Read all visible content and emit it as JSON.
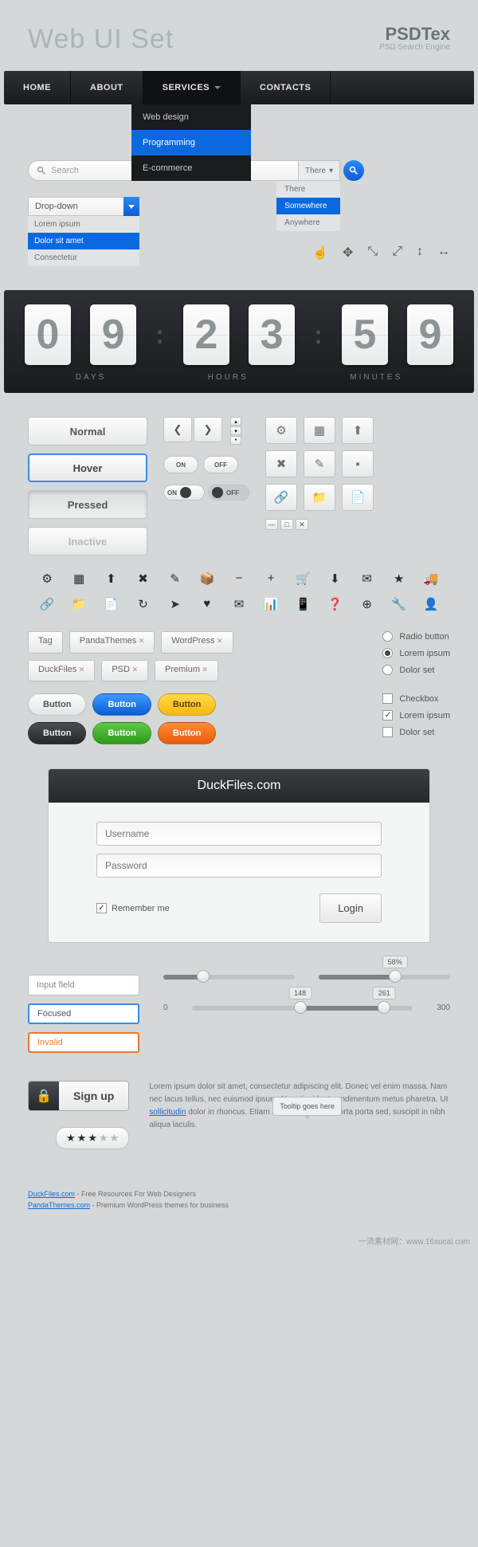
{
  "header": {
    "title": "Web UI Set",
    "brand": "PSD",
    "brand2": "Tex",
    "brand_sub": "PSD Search Engine"
  },
  "nav": {
    "items": [
      "HOME",
      "ABOUT",
      "SERVICES",
      "CONTACTS"
    ],
    "submenu": [
      "Web design",
      "Programming",
      "E-commerce"
    ]
  },
  "search1": {
    "placeholder": "Search"
  },
  "search2": {
    "placeholder": "Search",
    "selected": "There",
    "options": [
      "There",
      "Somewhere",
      "Anywhere"
    ]
  },
  "dropdown": {
    "label": "Drop-down",
    "items": [
      "Lorem ipsum",
      "Dolor sit amet",
      "Consectetur"
    ]
  },
  "counter": {
    "d1": "0",
    "d2": "9",
    "d3": "2",
    "d4": "3",
    "d5": "5",
    "d6": "9",
    "l1": "DAYS",
    "l2": "HOURS",
    "l3": "MINUTES"
  },
  "buttons": {
    "normal": "Normal",
    "hover": "Hover",
    "pressed": "Pressed",
    "inactive": "Inactive"
  },
  "toggles": {
    "on": "ON",
    "off": "OFF"
  },
  "tags": [
    "Tag",
    "PandaThemes",
    "WordPress",
    "DuckFiles",
    "PSD",
    "Premium"
  ],
  "radios": {
    "r1": "Radio button",
    "r2": "Lorem ipsum",
    "r3": "Dolor set"
  },
  "checks": {
    "c1": "Checkbox",
    "c2": "Lorem ipsum",
    "c3": "Dolor set"
  },
  "pills": {
    "label": "Button"
  },
  "login": {
    "title": "DuckFiles.com",
    "user": "Username",
    "pass": "Password",
    "remember": "Remember me",
    "btn": "Login"
  },
  "fields": {
    "normal": "Input field",
    "focus": "Focused",
    "invalid": "Invalid"
  },
  "sliders": {
    "pct": "58%",
    "v1": "148",
    "v2": "261",
    "min": "0",
    "max": "300"
  },
  "signup": {
    "label": "Sign up"
  },
  "lorem": {
    "text1": "Lorem ipsum dolor sit amet, consectetur adipiscing elit. Donec vel enim massa. Nam nec lacus tellus, nec euismod ipsum. Nam tincidunt condimentum metus pharetra. Ut ",
    "link": "sollicitudin",
    "text2": " dolor in rhoncus. Etiam sem nibh, feugiat porta porta sed, suscipit in nibh aliqua laculis.",
    "tooltip": "Tooltip goes here"
  },
  "footer": {
    "l1a": "DuckFiles.com",
    "l1b": " - Free Resources For Web Designers",
    "l2a": "PandaThemes.com",
    "l2b": " - Premium WordPress themes for business"
  },
  "credit": "一流素材网：www.16sucai.com"
}
